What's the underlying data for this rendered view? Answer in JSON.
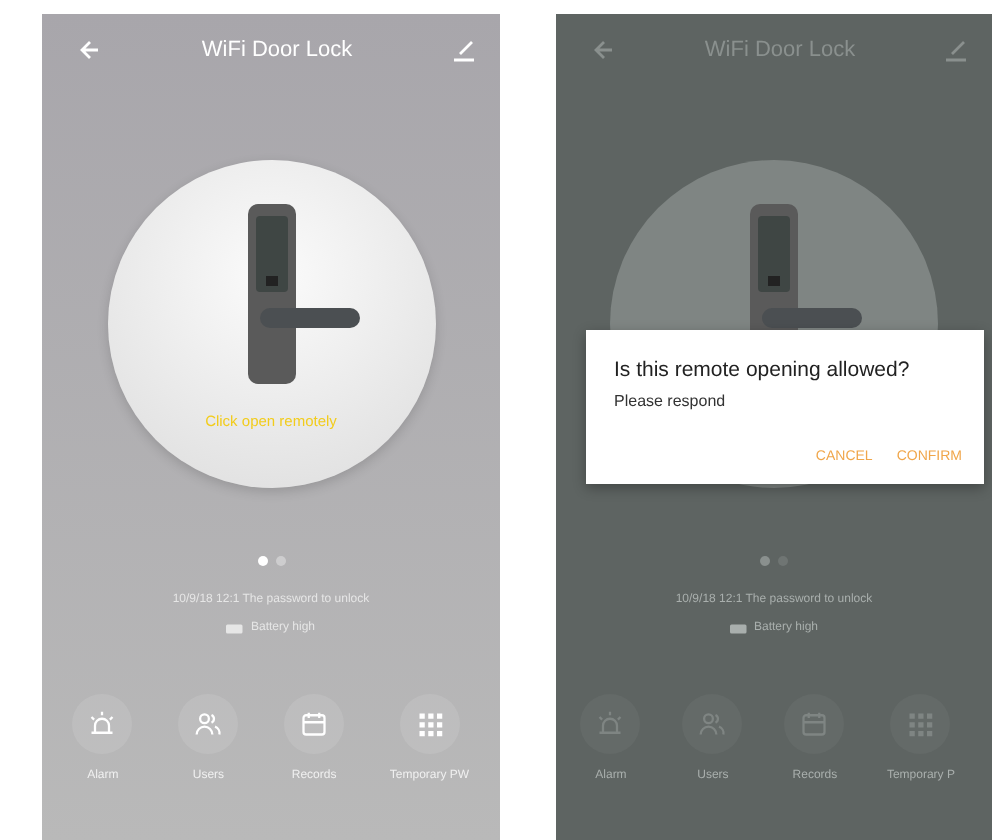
{
  "screens": [
    {
      "dimmed": false,
      "title": "WiFi Door Lock",
      "lock_prompt": "Click open remotely",
      "page_dots": [
        {
          "selected": true
        },
        {
          "selected": false
        }
      ],
      "status_text": "10/9/18 12:1 The password to unlock",
      "battery_text": "Battery high",
      "actions": [
        {
          "kind": "alarm",
          "label": "Alarm"
        },
        {
          "kind": "users",
          "label": "Users"
        },
        {
          "kind": "records",
          "label": "Records"
        },
        {
          "kind": "keypad",
          "label": "Temporary PW"
        }
      ]
    },
    {
      "dimmed": true,
      "title": "WiFi Door Lock",
      "page_dots": [
        {
          "selected": true
        },
        {
          "selected": false
        }
      ],
      "status_text": "10/9/18 12:1 The password to unlock",
      "battery_text": "Battery high",
      "actions": [
        {
          "kind": "alarm",
          "label": "Alarm"
        },
        {
          "kind": "users",
          "label": "Users"
        },
        {
          "kind": "records",
          "label": "Records"
        },
        {
          "kind": "keypad",
          "label": "Temporary P"
        }
      ],
      "dialog": {
        "title": "Is this remote opening allowed?",
        "message": "Please respond",
        "buttons": [
          "CANCEL",
          "CONFIRM"
        ]
      }
    }
  ]
}
